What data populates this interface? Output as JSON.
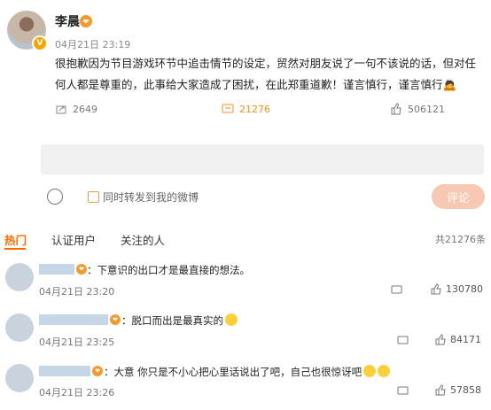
{
  "post": {
    "author": "李晨",
    "badge": "V",
    "fan_badge": "❤",
    "time": "04月21日 23:19",
    "text": "很抱歉因为节目游戏环节中追击情节的设定，贸然对朋友说了一句不该说的话，但对任何人都是尊重的，此事给大家造成了困扰，在此郑重道歉！谨言慎行，谨言慎行",
    "emoji": "🙇"
  },
  "actions": {
    "repost": "2649",
    "comment": "21276",
    "like": "506121"
  },
  "composer": {
    "placeholder": "",
    "repost_label": "同时转发到我的微博",
    "submit_label": "评论"
  },
  "tabs": {
    "hot": "热门",
    "verified": "认证用户",
    "followed": "关注的人",
    "total": "共21276条"
  },
  "comments": [
    {
      "text": "：下意识的出口才是最直接的想法。",
      "time": "04月21日 23:20",
      "likes": "130780"
    },
    {
      "text": "：脱口而出是最真实的",
      "time": "04月21日 23:25",
      "likes": "84171"
    },
    {
      "text": "：大意 你只是不小心把心里话说出了吧，自己也很惊讶吧",
      "time": "04月21日 23:26",
      "likes": "57858"
    }
  ],
  "icons": {
    "repost": "repost-icon",
    "comment": "comment-icon",
    "like": "thumbs-up-icon"
  },
  "colors": {
    "accent": "#ff6a00",
    "comment_active": "#f0911e",
    "submit_bg": "#f8c9b2"
  }
}
